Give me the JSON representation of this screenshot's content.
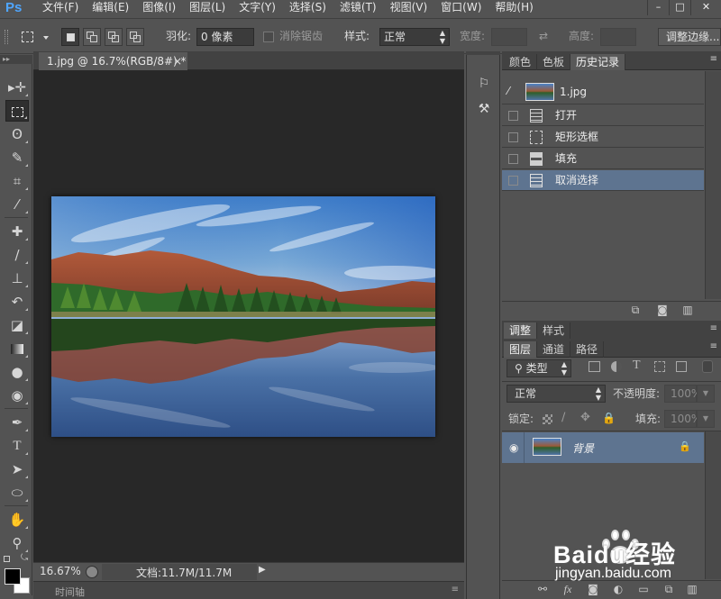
{
  "app": {
    "logo": "Ps"
  },
  "menu": [
    "文件(F)",
    "编辑(E)",
    "图像(I)",
    "图层(L)",
    "文字(Y)",
    "选择(S)",
    "滤镜(T)",
    "视图(V)",
    "窗口(W)",
    "帮助(H)"
  ],
  "window_controls": {
    "minimize": "–",
    "restore": "□",
    "close": "✕"
  },
  "options": {
    "feather_label": "羽化:",
    "feather_value": "0 像素",
    "antialias_label": "消除锯齿",
    "style_label": "样式:",
    "style_value": "正常",
    "width_label": "宽度:",
    "swap_icon": "⇄",
    "height_label": "高度:",
    "refine_edge": "调整边缘..."
  },
  "document": {
    "tab_title": "1.jpg @ 16.7%(RGB/8#) *",
    "tab_close": "×",
    "zoom": "16.67%",
    "doc_info": "文档:11.7M/11.7M",
    "timeline_label": "时间轴"
  },
  "history_panel": {
    "tabs": [
      "颜色",
      "色板",
      "历史记录"
    ],
    "active_tab": "历史记录",
    "snapshot_name": "1.jpg",
    "items": [
      {
        "label": "打开",
        "icon": "document-icon"
      },
      {
        "label": "矩形选框",
        "icon": "marquee-icon"
      },
      {
        "label": "填充",
        "icon": "fill-icon"
      },
      {
        "label": "取消选择",
        "icon": "document-icon"
      }
    ],
    "selected_index": 3
  },
  "adjust_panel": {
    "tabs": [
      "调整",
      "样式"
    ],
    "active_tab": "调整"
  },
  "layers_panel": {
    "tabs": [
      "图层",
      "通道",
      "路径"
    ],
    "active_tab": "图层",
    "filter_type": "类型",
    "blend_mode": "正常",
    "opacity_label": "不透明度:",
    "opacity_value": "100%",
    "lock_label": "锁定:",
    "fill_label": "填充:",
    "fill_value": "100%",
    "layers": [
      {
        "name": "背景",
        "visible": true,
        "locked": true
      }
    ]
  },
  "colors": {
    "panel_bg": "#535353",
    "canvas_bg": "#282828",
    "selection_blue": "#5e7490",
    "ps_logo_blue": "#4fa6ff"
  },
  "watermark": {
    "brand": "Baidu经验",
    "url": "jingyan.baidu.com"
  }
}
